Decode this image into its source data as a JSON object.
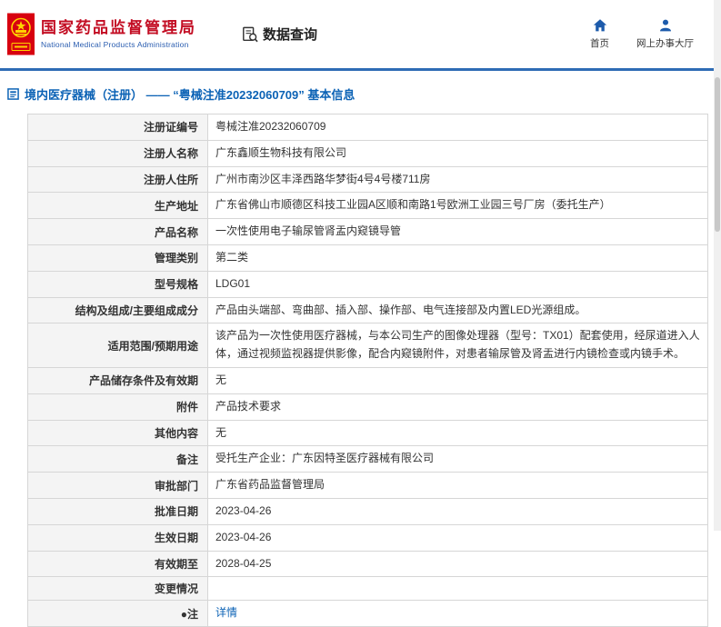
{
  "header": {
    "agency_cn": "国家药品监督管理局",
    "agency_en": "National Medical Products Administration",
    "data_query_label": "数据查询",
    "nav": [
      {
        "label": "首页",
        "icon": "home-icon"
      },
      {
        "label": "网上办事大厅",
        "icon": "user-icon"
      }
    ]
  },
  "colors": {
    "brand_red": "#c30d23",
    "brand_blue": "#2a5db0",
    "accent_blue": "#0b62b5",
    "divider_blue": "#2e6cb5"
  },
  "page": {
    "title": "境内医疗器械（注册） —— “粤械注准20232060709” 基本信息"
  },
  "table": {
    "rows": [
      {
        "label": "注册证编号",
        "value": "粤械注准20232060709"
      },
      {
        "label": "注册人名称",
        "value": "广东鑫顺生物科技有限公司"
      },
      {
        "label": "注册人住所",
        "value": "广州市南沙区丰泽西路华梦街4号4号楼711房"
      },
      {
        "label": "生产地址",
        "value": "广东省佛山市顺德区科技工业园A区顺和南路1号欧洲工业园三号厂房（委托生产）"
      },
      {
        "label": "产品名称",
        "value": "一次性使用电子输尿管肾盂内窥镜导管"
      },
      {
        "label": "管理类别",
        "value": "第二类"
      },
      {
        "label": "型号规格",
        "value": "LDG01"
      },
      {
        "label": "结构及组成/主要组成成分",
        "value": "产品由头端部、弯曲部、插入部、操作部、电气连接部及内置LED光源组成。"
      },
      {
        "label": "适用范围/预期用途",
        "value": "该产品为一次性使用医疗器械，与本公司生产的图像处理器（型号：TX01）配套使用，经尿道进入人体，通过视频监视器提供影像，配合内窥镜附件，对患者输尿管及肾盂进行内镜检查或内镜手术。"
      },
      {
        "label": "产品储存条件及有效期",
        "value": "无"
      },
      {
        "label": "附件",
        "value": "产品技术要求"
      },
      {
        "label": "其他内容",
        "value": "无"
      },
      {
        "label": "备注",
        "value": "受托生产企业：广东因特圣医疗器械有限公司"
      },
      {
        "label": "审批部门",
        "value": "广东省药品监督管理局"
      },
      {
        "label": "批准日期",
        "value": "2023-04-26"
      },
      {
        "label": "生效日期",
        "value": "2023-04-26"
      },
      {
        "label": "有效期至",
        "value": "2028-04-25"
      },
      {
        "label": "变更情况",
        "value": ""
      },
      {
        "label": "●注",
        "value": "详情"
      }
    ]
  }
}
